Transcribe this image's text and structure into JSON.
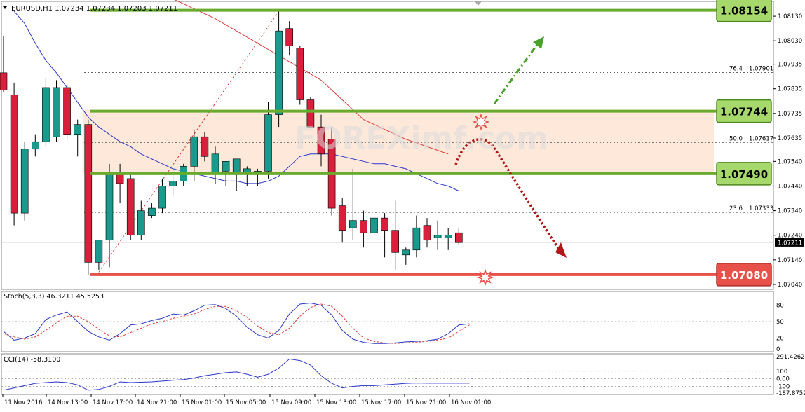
{
  "main_header": {
    "symbol_line": "EURUSD,H1  1.07234 1.07234 1.07203 1.07211"
  },
  "stoch_header": "Stoch(5,3,3) 46.3211 45.5253",
  "cci_header": "CCI(14) -58.3100",
  "watermark": "FOREXimf.com",
  "colors": {
    "bull_candle": "#1a9a8c",
    "bear_candle": "#d8203c",
    "level_green": "#6aab2e",
    "level_red": "#e8514a",
    "zone_fill": "#fde6d6",
    "ma_blue": "#2a36c9",
    "ma_red": "#e03a3a",
    "stoch_main": "#2a36c9",
    "stoch_signal": "#e03a3a",
    "cci_line": "#2a36c9"
  },
  "chart_data": [
    {
      "type": "candlestick",
      "title": "EURUSD,H1",
      "ohlc_header": [
        "1.07234",
        "1.07234",
        "1.07203",
        "1.07211"
      ],
      "ylim": [
        1.0702,
        1.0819
      ],
      "y_ticks": [
        "1.08130",
        "1.08030",
        "1.07935",
        "1.07835",
        "1.07735",
        "1.07635",
        "1.07540",
        "1.07440",
        "1.07340",
        "1.07240",
        "1.07140",
        "1.07040"
      ],
      "current_price": "1.07211",
      "x_ticks": [
        "11 Nov 2016",
        "14 Nov 13:00",
        "14 Nov 17:00",
        "14 Nov 21:00",
        "15 Nov 01:00",
        "15 Nov 05:00",
        "15 Nov 09:00",
        "15 Nov 13:00",
        "15 Nov 17:00",
        "15 Nov 21:00",
        "16 Nov 01:00"
      ],
      "candles": [
        {
          "o": 1.079,
          "h": 1.0805,
          "l": 1.0782,
          "c": 1.0783
        },
        {
          "o": 1.0781,
          "h": 1.0786,
          "l": 1.0728,
          "c": 1.0733
        },
        {
          "o": 1.0733,
          "h": 1.0762,
          "l": 1.073,
          "c": 1.0759
        },
        {
          "o": 1.0759,
          "h": 1.0765,
          "l": 1.0756,
          "c": 1.0762
        },
        {
          "o": 1.0762,
          "h": 1.0788,
          "l": 1.076,
          "c": 1.0784
        },
        {
          "o": 1.0764,
          "h": 1.0787,
          "l": 1.0762,
          "c": 1.0784
        },
        {
          "o": 1.0784,
          "h": 1.0785,
          "l": 1.0763,
          "c": 1.0765
        },
        {
          "o": 1.0765,
          "h": 1.0771,
          "l": 1.0756,
          "c": 1.0769
        },
        {
          "o": 1.0769,
          "h": 1.0771,
          "l": 1.0708,
          "c": 1.0713
        },
        {
          "o": 1.0713,
          "h": 1.0717,
          "l": 1.071,
          "c": 1.0722
        },
        {
          "o": 1.0722,
          "h": 1.0753,
          "l": 1.0711,
          "c": 1.0749
        },
        {
          "o": 1.0749,
          "h": 1.0753,
          "l": 1.0737,
          "c": 1.0745
        },
        {
          "o": 1.0747,
          "h": 1.0749,
          "l": 1.0722,
          "c": 1.0724
        },
        {
          "o": 1.0724,
          "h": 1.0738,
          "l": 1.0722,
          "c": 1.0734
        },
        {
          "o": 1.0732,
          "h": 1.0737,
          "l": 1.0731,
          "c": 1.0735
        },
        {
          "o": 1.0735,
          "h": 1.0747,
          "l": 1.0733,
          "c": 1.0744
        },
        {
          "o": 1.0744,
          "h": 1.0749,
          "l": 1.074,
          "c": 1.0746
        },
        {
          "o": 1.0746,
          "h": 1.0753,
          "l": 1.0744,
          "c": 1.0752
        },
        {
          "o": 1.0752,
          "h": 1.0767,
          "l": 1.0746,
          "c": 1.0764
        },
        {
          "o": 1.0764,
          "h": 1.0766,
          "l": 1.0754,
          "c": 1.0756
        },
        {
          "o": 1.0749,
          "h": 1.076,
          "l": 1.0745,
          "c": 1.0757
        },
        {
          "o": 1.075,
          "h": 1.0752,
          "l": 1.0744,
          "c": 1.0754
        },
        {
          "o": 1.0749,
          "h": 1.0751,
          "l": 1.0742,
          "c": 1.0755
        },
        {
          "o": 1.0749,
          "h": 1.0752,
          "l": 1.0744,
          "c": 1.0751
        },
        {
          "o": 1.0749,
          "h": 1.0751,
          "l": 1.0744,
          "c": 1.075
        },
        {
          "o": 1.075,
          "h": 1.0778,
          "l": 1.0747,
          "c": 1.0773
        },
        {
          "o": 1.0773,
          "h": 1.0815,
          "l": 1.0768,
          "c": 1.0807
        },
        {
          "o": 1.0808,
          "h": 1.0811,
          "l": 1.0797,
          "c": 1.0801
        },
        {
          "o": 1.08,
          "h": 1.0801,
          "l": 1.0777,
          "c": 1.0779
        },
        {
          "o": 1.0779,
          "h": 1.078,
          "l": 1.077,
          "c": 1.0768
        },
        {
          "o": 1.0768,
          "h": 1.0773,
          "l": 1.0752,
          "c": 1.0757
        },
        {
          "o": 1.0763,
          "h": 1.0768,
          "l": 1.0732,
          "c": 1.0735
        },
        {
          "o": 1.0736,
          "h": 1.0739,
          "l": 1.0721,
          "c": 1.0726
        },
        {
          "o": 1.0727,
          "h": 1.0751,
          "l": 1.0722,
          "c": 1.073
        },
        {
          "o": 1.073,
          "h": 1.0734,
          "l": 1.0719,
          "c": 1.0725
        },
        {
          "o": 1.0725,
          "h": 1.0731,
          "l": 1.0722,
          "c": 1.0731
        },
        {
          "o": 1.0731,
          "h": 1.0733,
          "l": 1.0715,
          "c": 1.0726
        },
        {
          "o": 1.0726,
          "h": 1.0738,
          "l": 1.071,
          "c": 1.0717
        },
        {
          "o": 1.0716,
          "h": 1.0719,
          "l": 1.0712,
          "c": 1.0718
        },
        {
          "o": 1.0718,
          "h": 1.0732,
          "l": 1.0715,
          "c": 1.0727
        },
        {
          "o": 1.0728,
          "h": 1.0731,
          "l": 1.0719,
          "c": 1.0722
        },
        {
          "o": 1.0723,
          "h": 1.073,
          "l": 1.0718,
          "c": 1.0724
        },
        {
          "o": 1.0723,
          "h": 1.0727,
          "l": 1.0718,
          "c": 1.0724
        },
        {
          "o": 1.0725,
          "h": 1.0727,
          "l": 1.072,
          "c": 1.0721
        }
      ],
      "levels": [
        {
          "label": "1.08154",
          "value": 1.08154,
          "color": "green"
        },
        {
          "label": "1.07744",
          "value": 1.07744,
          "color": "green"
        },
        {
          "label": "1.07490",
          "value": 1.0749,
          "color": "green"
        },
        {
          "label": "1.07080",
          "value": 1.0708,
          "color": "red"
        }
      ],
      "fib_levels": [
        {
          "label": "76.4",
          "price": "1.07901"
        },
        {
          "label": "50.0",
          "price": "1.07617"
        },
        {
          "label": "23.6",
          "price": "1.07333"
        }
      ],
      "zone": [
        1.0749,
        1.0775
      ]
    },
    {
      "type": "line",
      "title": "Stoch(5,3,3) 46.3211 45.5253",
      "ylim": [
        0,
        100
      ],
      "y_ticks": [
        "80",
        "50",
        "20",
        "0"
      ],
      "series": [
        {
          "name": "Main",
          "values": [
            32,
            16,
            20,
            28,
            54,
            62,
            68,
            50,
            32,
            22,
            16,
            28,
            44,
            46,
            52,
            56,
            64,
            62,
            70,
            80,
            81,
            74,
            60,
            40,
            26,
            20,
            34,
            64,
            82,
            84,
            80,
            62,
            34,
            18,
            12,
            10,
            10,
            11,
            13,
            14,
            15,
            18,
            28,
            44,
            46
          ]
        },
        {
          "name": "Signal",
          "values": [
            28,
            22,
            18,
            22,
            34,
            48,
            60,
            60,
            50,
            36,
            24,
            22,
            30,
            38,
            46,
            50,
            56,
            60,
            64,
            72,
            78,
            78,
            70,
            58,
            42,
            30,
            26,
            38,
            60,
            76,
            82,
            78,
            60,
            38,
            20,
            14,
            11,
            10,
            11,
            12,
            14,
            16,
            20,
            32,
            44
          ]
        }
      ]
    },
    {
      "type": "line",
      "title": "CCI(14) -58.3100",
      "y_ticks": [
        "291.4262",
        "100",
        "0.00",
        "-100",
        "-187.8752"
      ],
      "ylim": [
        -187.8752,
        291.4262
      ],
      "series": [
        {
          "name": "CCI(14)",
          "values": [
            -150,
            -120,
            -90,
            -60,
            -50,
            -40,
            -50,
            -80,
            -150,
            -140,
            -100,
            -40,
            -50,
            -45,
            -40,
            -30,
            -20,
            -10,
            10,
            40,
            60,
            80,
            90,
            60,
            20,
            60,
            140,
            260,
            240,
            180,
            40,
            -60,
            -120,
            -100,
            -90,
            -90,
            -80,
            -70,
            -60,
            -55,
            -58,
            -58,
            -58,
            -58,
            -58
          ]
        }
      ]
    }
  ]
}
